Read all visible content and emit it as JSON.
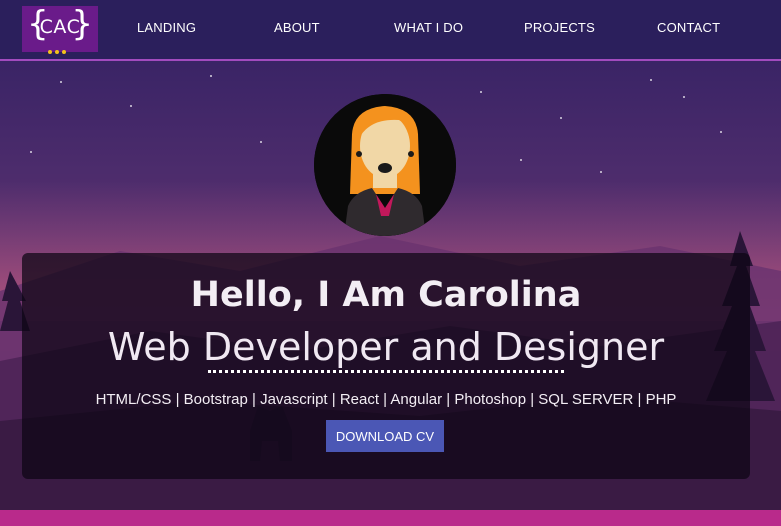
{
  "logo": {
    "text": "CAC",
    "brace_left": "{",
    "brace_right": "}"
  },
  "nav": {
    "items": [
      {
        "label": "LANDING"
      },
      {
        "label": "ABOUT"
      },
      {
        "label": "WHAT I DO"
      },
      {
        "label": "PROJECTS"
      },
      {
        "label": "CONTACT"
      }
    ]
  },
  "hero": {
    "title": "Hello, I Am Carolina",
    "subtitle": "Web Developer and Designer",
    "skills": "HTML/CSS | Bootstrap | Javascript | React | Angular | Photoshop | SQL SERVER | PHP",
    "button_label": "DOWNLOAD CV"
  },
  "colors": {
    "nav_bg": "#2b1f5c",
    "accent": "#b92a8b",
    "button": "#4b57b5",
    "logo_bg": "#6a1b8a"
  }
}
